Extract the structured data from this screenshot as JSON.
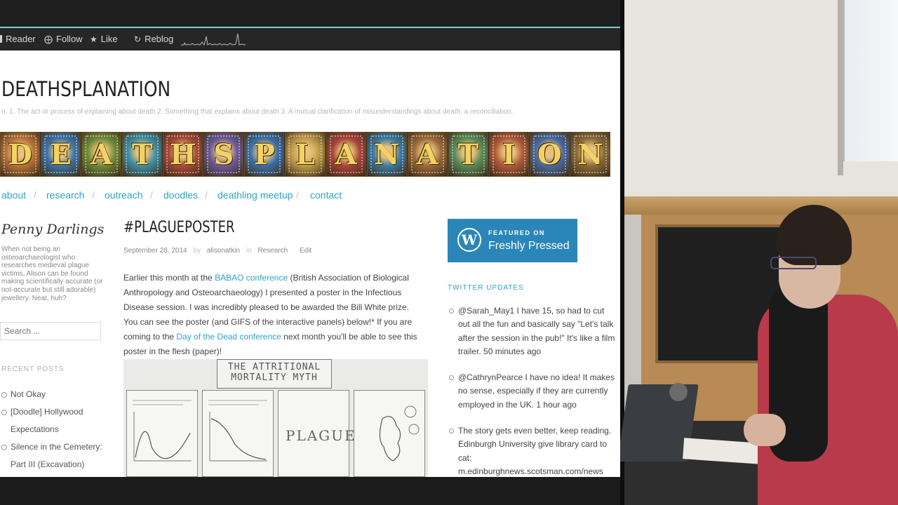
{
  "toolbar": {
    "reader": "Reader",
    "follow": "Follow",
    "like": "Like",
    "reblog": "Reblog",
    "icons": [
      "reader-icon",
      "follow-icon",
      "like-icon",
      "reblog-icon",
      "stats-sparkline"
    ]
  },
  "site": {
    "title": "DEATHSPLANATION",
    "description": "n. 1. The act or process of explaining about death 2. Something that explains about death 3. A mutual clarification of misunderstandings about death; a reconciliation.",
    "banner_letters": [
      "D",
      "E",
      "A",
      "T",
      "H",
      "S",
      "P",
      "L",
      "A",
      "N",
      "A",
      "T",
      "I",
      "O",
      "N"
    ]
  },
  "nav": {
    "items": [
      "about",
      "research",
      "outreach",
      "doodles",
      "deathling meetup",
      "contact"
    ],
    "separator": "/"
  },
  "sidebar": {
    "author": "Penny Darlings",
    "bio": "When not being an osteoarchaeologist who researches medieval plague victims, Alison can be found making scientifically accurate (or not-accurate but still adorable) jewellery. Neat, huh?",
    "search_placeholder": "Search ...",
    "recent_heading": "RECENT POSTS",
    "recent_posts": [
      {
        "line1": "Not Okay",
        "line2": ""
      },
      {
        "line1": "[Doodle] Hollywood",
        "line2": "Expectations"
      },
      {
        "line1": "Silence in the Cemetery:",
        "line2": "Part III (Excavation)"
      }
    ]
  },
  "post": {
    "title": "#PLAGUEPOSTER",
    "date": "September 28, 2014",
    "by": "by",
    "author": "alisonatkin",
    "in": "in",
    "category": "Research",
    "edit": "Edit",
    "body_1": "Earlier this month at the ",
    "link_1": "BABAO conference",
    "body_2": " (British Association of Biological Anthropology and Osteoarchaeology) I presented a poster in the Infectious Disease session. I was incredibly pleased to be awarded the Bill White prize. You can see the poster (and GIFS of the interactive panels) below!* If you are coming to the ",
    "link_2": "Day of the Dead conference",
    "body_3": " next month you'll be able to see this poster in the flesh (paper)!",
    "poster_title_1": "THE ATTRITIONAL",
    "poster_title_2": "MORTALITY MYTH",
    "poster_panel_word": "PLAGUE"
  },
  "right_sidebar": {
    "badge_line1": "FEATURED ON",
    "badge_line2": "Freshly Pressed",
    "twitter_heading": "TWITTER UPDATES",
    "tweets": [
      {
        "text": "@Sarah_May1 I have 15, so had to cut out all the fun and basically say \"Let's talk after the session in the pub!\" It's like a film trailer.",
        "time": "50 minutes ago"
      },
      {
        "text": "@CathrynPearce I have no idea! It makes no sense, especially if they are currently employed in the UK.",
        "time": "1 hour ago"
      },
      {
        "text": "The story gets even better, keep reading. Edinburgh University give library card to cat:",
        "time": "m.edinburghnews.scotsman.com/news"
      }
    ]
  },
  "colors": {
    "link": "#2ea3c6",
    "badge": "#2a86b8",
    "toolbar_bg": "#262626",
    "toolbar_accent": "#7ecfd6"
  }
}
